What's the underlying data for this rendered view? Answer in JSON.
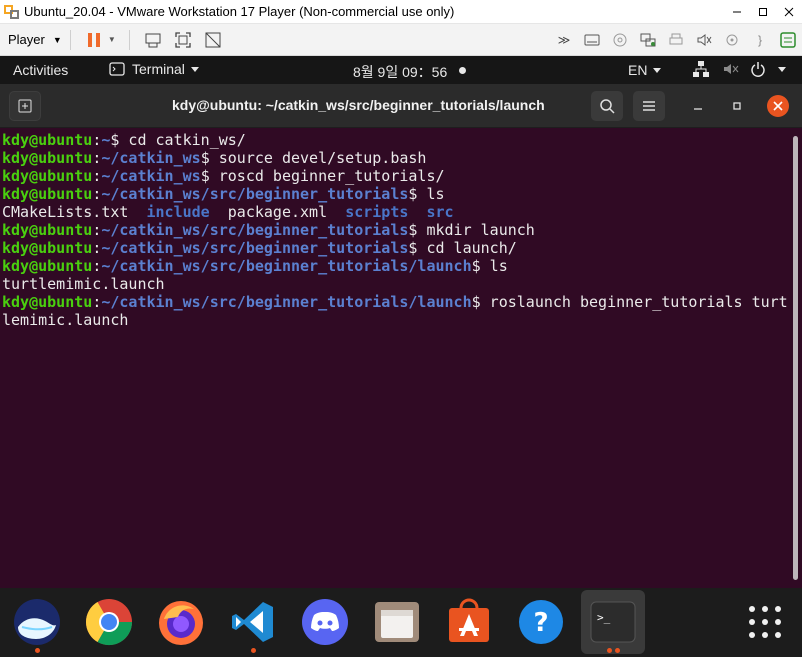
{
  "window": {
    "title": "Ubuntu_20.04 - VMware Workstation 17 Player (Non-commercial use only)",
    "controls": [
      "minimize-icon",
      "maximize-icon",
      "close-icon"
    ]
  },
  "vmware_toolbar": {
    "player_label": "Player",
    "icons": [
      "pause-icon",
      "send-keys-icon",
      "fullscreen-icon",
      "unity-icon"
    ],
    "right_icons": [
      "more-icon",
      "hdd-icon",
      "cd-icon",
      "network-icon",
      "printer-icon",
      "sound-icon",
      "usb-icon",
      "message-icon"
    ]
  },
  "gnome": {
    "activities": "Activities",
    "app_menu": "Terminal",
    "clock": "8월 9일  09：56",
    "lang": "EN"
  },
  "terminal": {
    "title": "kdy@ubuntu: ~/catkin_ws/src/beginner_tutorials/launch",
    "lines": [
      {
        "user": "kdy@ubuntu",
        "path": "~",
        "cmd": " cd catkin_ws/"
      },
      {
        "user": "kdy@ubuntu",
        "path": "~/catkin_ws",
        "cmd": " source devel/setup.bash"
      },
      {
        "user": "kdy@ubuntu",
        "path": "~/catkin_ws",
        "cmd": " roscd beginner_tutorials/"
      },
      {
        "user": "kdy@ubuntu",
        "path": "~/catkin_ws/src/beginner_tutorials",
        "cmd": " ls"
      },
      {
        "output_files": [
          {
            "name": "CMakeLists.txt",
            "dir": false
          },
          {
            "name": "include",
            "dir": true
          },
          {
            "name": "package.xml",
            "dir": false
          },
          {
            "name": "scripts",
            "dir": true
          },
          {
            "name": "src",
            "dir": true
          }
        ]
      },
      {
        "user": "kdy@ubuntu",
        "path": "~/catkin_ws/src/beginner_tutorials",
        "cmd": " mkdir launch"
      },
      {
        "user": "kdy@ubuntu",
        "path": "~/catkin_ws/src/beginner_tutorials",
        "cmd": " cd launch/"
      },
      {
        "user": "kdy@ubuntu",
        "path": "~/catkin_ws/src/beginner_tutorials/launch",
        "cmd": " ls"
      },
      {
        "output": "turtlemimic.launch"
      },
      {
        "user": "kdy@ubuntu",
        "path": "~/catkin_ws/src/beginner_tutorials/launch",
        "cmd": " roslaunch beginner_tutorials turt"
      },
      {
        "output": "lemimic.launch"
      }
    ]
  },
  "dock": {
    "apps": [
      "whale-browser-icon",
      "chrome-icon",
      "firefox-icon",
      "vscode-icon",
      "discord-icon",
      "files-icon",
      "software-center-icon",
      "help-icon",
      "terminal-icon",
      "show-apps-icon"
    ]
  },
  "colors": {
    "terminal_bg": "#300a24",
    "prompt_user": "#4ad00f",
    "prompt_path": "#5b80d0",
    "ubuntu_orange": "#e95420"
  }
}
